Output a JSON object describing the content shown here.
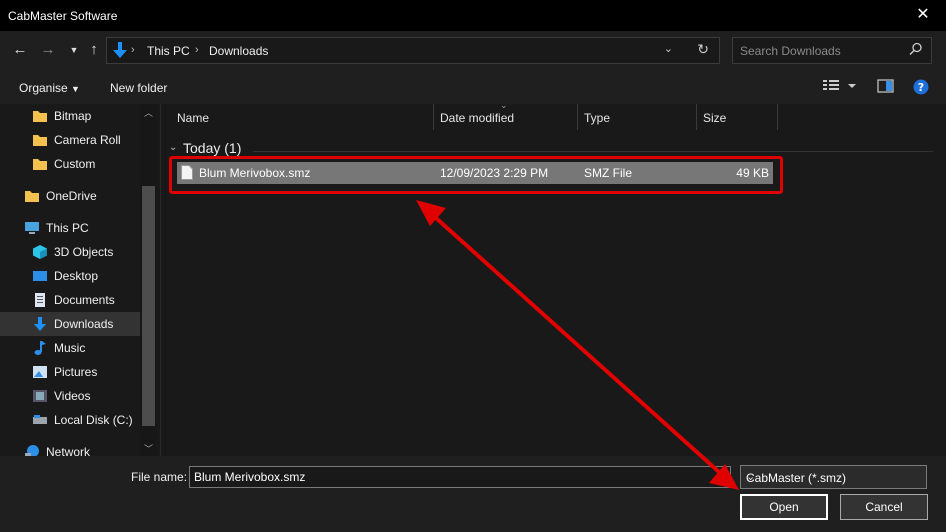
{
  "window": {
    "title": "CabMaster Software"
  },
  "address": {
    "crumbs": [
      "This PC",
      "Downloads"
    ]
  },
  "search": {
    "placeholder": "Search Downloads"
  },
  "toolbar": {
    "organise": "Organise",
    "new_folder": "New folder"
  },
  "nav": {
    "items": [
      {
        "label": "Bitmap",
        "icon": "folder-icon"
      },
      {
        "label": "Camera Roll",
        "icon": "folder-icon"
      },
      {
        "label": "Custom",
        "icon": "folder-icon"
      },
      {
        "label": "OneDrive",
        "icon": "folder-icon"
      },
      {
        "label": "This PC",
        "icon": "computer-icon"
      },
      {
        "label": "3D Objects",
        "icon": "cube-icon"
      },
      {
        "label": "Desktop",
        "icon": "desktop-icon"
      },
      {
        "label": "Documents",
        "icon": "document-icon"
      },
      {
        "label": "Downloads",
        "icon": "download-icon",
        "selected": true
      },
      {
        "label": "Music",
        "icon": "music-icon"
      },
      {
        "label": "Pictures",
        "icon": "pictures-icon"
      },
      {
        "label": "Videos",
        "icon": "video-icon"
      },
      {
        "label": "Local Disk (C:)",
        "icon": "drive-icon"
      },
      {
        "label": "Network",
        "icon": "network-icon"
      }
    ]
  },
  "columns": [
    "Name",
    "Date modified",
    "Type",
    "Size"
  ],
  "group": {
    "label": "Today (1)"
  },
  "files": [
    {
      "name": "Blum Merivobox.smz",
      "date": "12/09/2023 2:29 PM",
      "type": "SMZ File",
      "size": "49 KB"
    }
  ],
  "footer": {
    "file_name_label": "File name:",
    "file_name_value": "Blum Merivobox.smz",
    "filter": "CabMaster (*.smz)",
    "open": "Open",
    "cancel": "Cancel"
  },
  "colors": {
    "annotation": "#e00000",
    "selection": "#777777",
    "accent_blue": "#1e90ff"
  }
}
